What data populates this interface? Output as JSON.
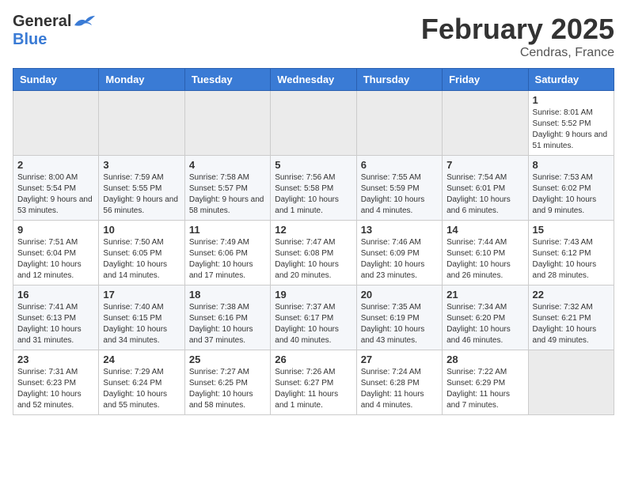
{
  "header": {
    "logo_general": "General",
    "logo_blue": "Blue",
    "month_title": "February 2025",
    "subtitle": "Cendras, France"
  },
  "weekdays": [
    "Sunday",
    "Monday",
    "Tuesday",
    "Wednesday",
    "Thursday",
    "Friday",
    "Saturday"
  ],
  "weeks": [
    [
      {
        "day": "",
        "info": ""
      },
      {
        "day": "",
        "info": ""
      },
      {
        "day": "",
        "info": ""
      },
      {
        "day": "",
        "info": ""
      },
      {
        "day": "",
        "info": ""
      },
      {
        "day": "",
        "info": ""
      },
      {
        "day": "1",
        "info": "Sunrise: 8:01 AM\nSunset: 5:52 PM\nDaylight: 9 hours and 51 minutes."
      }
    ],
    [
      {
        "day": "2",
        "info": "Sunrise: 8:00 AM\nSunset: 5:54 PM\nDaylight: 9 hours and 53 minutes."
      },
      {
        "day": "3",
        "info": "Sunrise: 7:59 AM\nSunset: 5:55 PM\nDaylight: 9 hours and 56 minutes."
      },
      {
        "day": "4",
        "info": "Sunrise: 7:58 AM\nSunset: 5:57 PM\nDaylight: 9 hours and 58 minutes."
      },
      {
        "day": "5",
        "info": "Sunrise: 7:56 AM\nSunset: 5:58 PM\nDaylight: 10 hours and 1 minute."
      },
      {
        "day": "6",
        "info": "Sunrise: 7:55 AM\nSunset: 5:59 PM\nDaylight: 10 hours and 4 minutes."
      },
      {
        "day": "7",
        "info": "Sunrise: 7:54 AM\nSunset: 6:01 PM\nDaylight: 10 hours and 6 minutes."
      },
      {
        "day": "8",
        "info": "Sunrise: 7:53 AM\nSunset: 6:02 PM\nDaylight: 10 hours and 9 minutes."
      }
    ],
    [
      {
        "day": "9",
        "info": "Sunrise: 7:51 AM\nSunset: 6:04 PM\nDaylight: 10 hours and 12 minutes."
      },
      {
        "day": "10",
        "info": "Sunrise: 7:50 AM\nSunset: 6:05 PM\nDaylight: 10 hours and 14 minutes."
      },
      {
        "day": "11",
        "info": "Sunrise: 7:49 AM\nSunset: 6:06 PM\nDaylight: 10 hours and 17 minutes."
      },
      {
        "day": "12",
        "info": "Sunrise: 7:47 AM\nSunset: 6:08 PM\nDaylight: 10 hours and 20 minutes."
      },
      {
        "day": "13",
        "info": "Sunrise: 7:46 AM\nSunset: 6:09 PM\nDaylight: 10 hours and 23 minutes."
      },
      {
        "day": "14",
        "info": "Sunrise: 7:44 AM\nSunset: 6:10 PM\nDaylight: 10 hours and 26 minutes."
      },
      {
        "day": "15",
        "info": "Sunrise: 7:43 AM\nSunset: 6:12 PM\nDaylight: 10 hours and 28 minutes."
      }
    ],
    [
      {
        "day": "16",
        "info": "Sunrise: 7:41 AM\nSunset: 6:13 PM\nDaylight: 10 hours and 31 minutes."
      },
      {
        "day": "17",
        "info": "Sunrise: 7:40 AM\nSunset: 6:15 PM\nDaylight: 10 hours and 34 minutes."
      },
      {
        "day": "18",
        "info": "Sunrise: 7:38 AM\nSunset: 6:16 PM\nDaylight: 10 hours and 37 minutes."
      },
      {
        "day": "19",
        "info": "Sunrise: 7:37 AM\nSunset: 6:17 PM\nDaylight: 10 hours and 40 minutes."
      },
      {
        "day": "20",
        "info": "Sunrise: 7:35 AM\nSunset: 6:19 PM\nDaylight: 10 hours and 43 minutes."
      },
      {
        "day": "21",
        "info": "Sunrise: 7:34 AM\nSunset: 6:20 PM\nDaylight: 10 hours and 46 minutes."
      },
      {
        "day": "22",
        "info": "Sunrise: 7:32 AM\nSunset: 6:21 PM\nDaylight: 10 hours and 49 minutes."
      }
    ],
    [
      {
        "day": "23",
        "info": "Sunrise: 7:31 AM\nSunset: 6:23 PM\nDaylight: 10 hours and 52 minutes."
      },
      {
        "day": "24",
        "info": "Sunrise: 7:29 AM\nSunset: 6:24 PM\nDaylight: 10 hours and 55 minutes."
      },
      {
        "day": "25",
        "info": "Sunrise: 7:27 AM\nSunset: 6:25 PM\nDaylight: 10 hours and 58 minutes."
      },
      {
        "day": "26",
        "info": "Sunrise: 7:26 AM\nSunset: 6:27 PM\nDaylight: 11 hours and 1 minute."
      },
      {
        "day": "27",
        "info": "Sunrise: 7:24 AM\nSunset: 6:28 PM\nDaylight: 11 hours and 4 minutes."
      },
      {
        "day": "28",
        "info": "Sunrise: 7:22 AM\nSunset: 6:29 PM\nDaylight: 11 hours and 7 minutes."
      },
      {
        "day": "",
        "info": ""
      }
    ]
  ]
}
